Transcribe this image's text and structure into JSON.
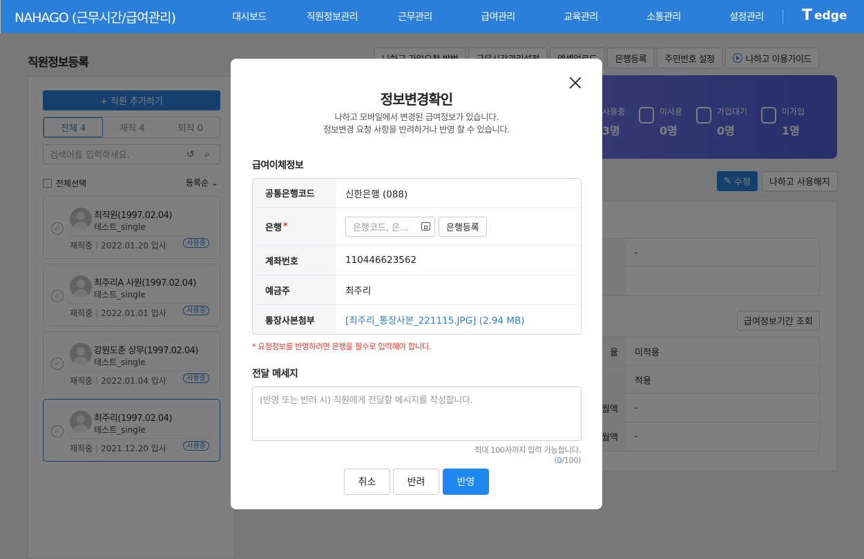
{
  "header": {
    "brand": "NAHAGO (근무시간/급여관리)",
    "nav": [
      "대시보드",
      "직원정보관리",
      "근무관리",
      "급여관리",
      "교육관리",
      "소통관리",
      "설정관리"
    ],
    "logo_text": "edge",
    "logo_mark": "T"
  },
  "page": {
    "title": "직원정보등록",
    "top_buttons": [
      "나하고 가입요청 방법",
      "근무시간관리설정",
      "엑셀업로드",
      "은행등록",
      "주민번호 설정",
      "나하고 이용가이드"
    ]
  },
  "sidebar": {
    "add_button": "+ 직원 추가하기",
    "tabs": [
      "전체 4",
      "재직 4",
      "퇴직 0"
    ],
    "search_placeholder": "검색어를 입력하세요.",
    "select_all": "전체선택",
    "sort": "등록순",
    "employees": [
      {
        "name": "최직원(1997.02.04)",
        "org": "테스트_single",
        "status": "재직중",
        "date": "2022.01.20 입사",
        "badge": "사용중"
      },
      {
        "name": "최주리A 사원(1997.02.04)",
        "org": "테스트_single",
        "status": "재직중",
        "date": "2022.01.01 입사",
        "badge": "사용중"
      },
      {
        "name": "강원도춘 상무(1997.02.04)",
        "org": "테스트_single",
        "status": "재직중",
        "date": "2022.01.04 입사",
        "badge": "사용중"
      },
      {
        "name": "최주리(1997.02.04)",
        "org": "테스트_single",
        "status": "재직중",
        "date": "2021.12.20 입사",
        "badge": "사용중"
      }
    ]
  },
  "stats": [
    {
      "label": "사용중",
      "value": "3명"
    },
    {
      "label": "미사용",
      "value": "0명"
    },
    {
      "label": "가입대기",
      "value": "0명"
    },
    {
      "label": "미가입",
      "value": "1명"
    }
  ],
  "detail": {
    "edit_button": "수정",
    "stop_button": "나하고 사용해지",
    "period_button": "급여정보기간 조회",
    "top_rows": [
      {
        "key": "",
        "value": "-"
      },
      {
        "key": "",
        "value": ""
      }
    ],
    "rows": [
      {
        "key": "율",
        "value": "미적용"
      },
      {
        "key": "",
        "value": "적용"
      },
      {
        "key": "월액",
        "value": "-"
      },
      {
        "key": "월액",
        "value": "-"
      }
    ]
  },
  "modal": {
    "title": "정보변경확인",
    "subtitle_line1": "나하고 모바일에서 변경된 급여정보가 있습니다.",
    "subtitle_line2": "정보변경 요청 사항을 반려하거나 반영 할 수 있습니다.",
    "section_transfer": "급여이체정보",
    "fields": {
      "bank_code_label": "공통은행코드",
      "bank_code_value": "신한은행 (088)",
      "bank_label": "은행",
      "bank_required": "*",
      "bank_placeholder": "은행코드, 은...",
      "bank_register": "은행등록",
      "account_label": "계좌번호",
      "account_value": "110446623562",
      "holder_label": "예금주",
      "holder_value": "최주리",
      "attach_label": "통장사본첨부",
      "attach_value": "[최주리_통장사본_221115.JPG] (2.94 MB)"
    },
    "warning": "* 요청정보를 반영하려면 은행을 필수로 입력해야 합니다.",
    "section_message": "전달 메세지",
    "message_placeholder": "(반영 또는 반려 시) 직원에게 전달할 메시지를 작성합니다.",
    "counter_prefix": "최대 100자까지 입력 가능합니다. (",
    "counter_current": "0",
    "counter_suffix": "/100)",
    "buttons": {
      "cancel": "취소",
      "reject": "반려",
      "apply": "반영"
    }
  }
}
